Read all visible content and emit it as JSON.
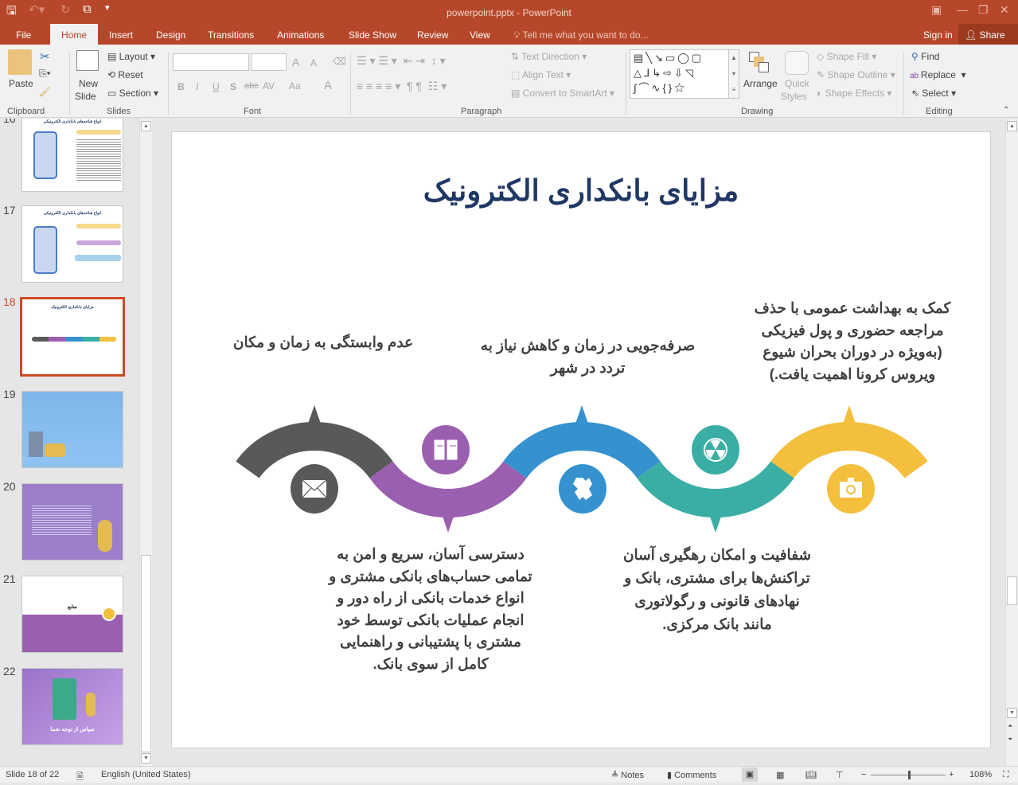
{
  "app": {
    "title": "powerpoint.pptx - PowerPoint",
    "accent": "#b7472a"
  },
  "qat": {
    "save_icon": "save-icon",
    "undo_icon": "undo-icon",
    "redo_icon": "redo-icon",
    "present_icon": "start-presentation-icon",
    "customize_icon": "customize-qat-icon"
  },
  "window": {
    "ribbon_display": "▣",
    "minimize": "—",
    "restore": "❐",
    "close": "✕"
  },
  "tabs": [
    "File",
    "Home",
    "Insert",
    "Design",
    "Transitions",
    "Animations",
    "Slide Show",
    "Review",
    "View"
  ],
  "tell_me": "Tell me what you want to do...",
  "sign_in": "Sign in",
  "share": "Share",
  "ribbon": {
    "clipboard": {
      "label": "Clipboard",
      "paste": "Paste"
    },
    "slides": {
      "label": "Slides",
      "new_slide_1": "New",
      "new_slide_2": "Slide",
      "layout": "Layout",
      "reset": "Reset",
      "section": "Section"
    },
    "font": {
      "label": "Font",
      "font_name": "",
      "font_size": "",
      "bold": "B",
      "italic": "I",
      "underline": "U",
      "shadow": "S",
      "strike": "abc",
      "spacing": "AV",
      "case": "Aa",
      "color": "A",
      "grow": "A",
      "shrink": "A"
    },
    "paragraph": {
      "label": "Paragraph",
      "text_direction": "Text Direction",
      "align_text": "Align Text",
      "smartart": "Convert to SmartArt"
    },
    "drawing": {
      "label": "Drawing",
      "arrange": "Arrange",
      "quick_1": "Quick",
      "quick_2": "Styles",
      "shape_fill": "Shape Fill",
      "shape_outline": "Shape Outline",
      "shape_effects": "Shape Effects"
    },
    "editing": {
      "label": "Editing",
      "find": "Find",
      "replace": "Replace",
      "select": "Select"
    }
  },
  "thumbnails": [
    {
      "num": "16",
      "title": "انواع شاخه‌های بانکداری الکترونیکی"
    },
    {
      "num": "17",
      "title": "انواع شاخه‌های بانکداری الکترونیکی"
    },
    {
      "num": "18",
      "title": "مزایای بانکداری الکترونیک",
      "selected": true
    },
    {
      "num": "19",
      "title": ""
    },
    {
      "num": "20",
      "title": ""
    },
    {
      "num": "21",
      "title": "منابع"
    },
    {
      "num": "22",
      "title": "سپاس از توجه شما"
    }
  ],
  "slide": {
    "title": "مزایای بانکداری الکترونیک",
    "top_left": "عدم وابستگی به زمان و مکان",
    "top_middle": [
      "صرفه‌جویی در زمان و کاهش نیاز به",
      "تردد در شهر"
    ],
    "top_right": [
      "کمک به بهداشت عمومی با حذف",
      "مراجعه حضوری و پول فیزیکی",
      "(به‌ویژه در دوران بحران شیوع",
      "ویروس کرونا اهمیت یافت.)"
    ],
    "bottom_left": [
      "دسترسی آسان، سریع و امن به",
      "تمامی حساب‌های بانکی مشتری و",
      "انواع خدمات بانکی از راه دور و",
      "انجام عملیات بانکی توسط خود",
      "مشتری با پشتیبانی و راهنمایی",
      "کامل از سوی بانک."
    ],
    "bottom_right": [
      "شفافیت و امکان رهگیری آسان",
      "تراکنش‌ها برای مشتری، بانک و",
      "نهادهای قانونی و رگولاتوری",
      "مانند بانک مرکزی."
    ],
    "segments": [
      {
        "color": "#595959",
        "icon": "mail-icon"
      },
      {
        "color": "#9b5fb0",
        "icon": "book-icon"
      },
      {
        "color": "#3592cf",
        "icon": "puzzle-icon"
      },
      {
        "color": "#3aaea4",
        "icon": "radiation-icon"
      },
      {
        "color": "#f3bf3d",
        "icon": "camera-icon"
      }
    ]
  },
  "status": {
    "slide": "Slide 18 of 22",
    "language": "English (United States)",
    "notes": "Notes",
    "comments": "Comments",
    "zoom": "108%",
    "zoom_level": 108
  }
}
